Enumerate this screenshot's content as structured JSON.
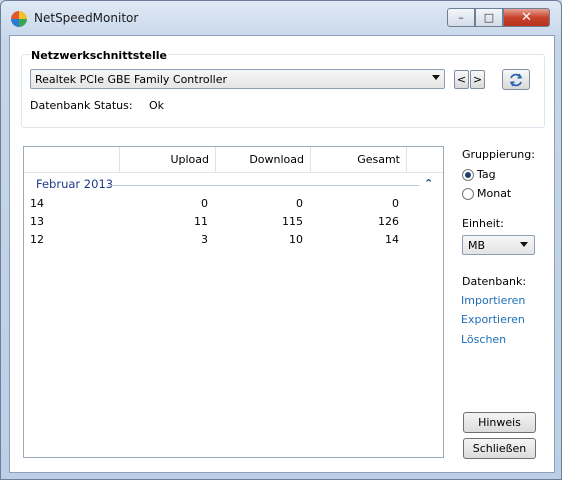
{
  "window": {
    "title": "NetSpeedMonitor",
    "controls": {
      "minimize": "–",
      "maximize": "□",
      "close": "✕"
    }
  },
  "interface_group": {
    "title": "Netzwerkschnittstelle",
    "adapter": "Realtek PCIe GBE Family Controller",
    "prev": "<",
    "next": ">",
    "db_status_label": "Datenbank Status:",
    "db_status_value": "Ok"
  },
  "table": {
    "columns": [
      "",
      "Upload",
      "Download",
      "Gesamt"
    ],
    "group": "Februar 2013",
    "rows": [
      [
        "14",
        "0",
        "0",
        "0"
      ],
      [
        "13",
        "11",
        "115",
        "126"
      ],
      [
        "12",
        "3",
        "10",
        "14"
      ]
    ]
  },
  "sidebar": {
    "grouping_label": "Gruppierung:",
    "options": [
      "Tag",
      "Monat"
    ],
    "selected": "Tag",
    "unit_label": "Einheit:",
    "unit_value": "MB",
    "database_label": "Datenbank:",
    "links": [
      "Importieren",
      "Exportieren",
      "Löschen"
    ],
    "hint_button": "Hinweis",
    "close_button": "Schließen"
  }
}
